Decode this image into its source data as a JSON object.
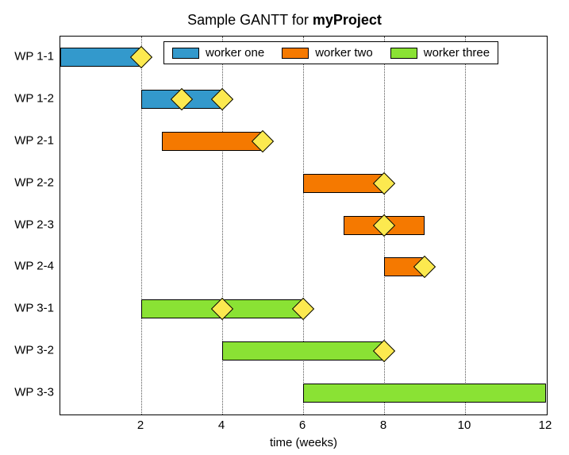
{
  "chart_data": {
    "type": "gantt",
    "title_prefix": "Sample GANTT for ",
    "title_bold": "myProject",
    "xlabel": "time (weeks)",
    "x_range": [
      0,
      12
    ],
    "x_ticks": [
      2,
      4,
      6,
      8,
      10,
      12
    ],
    "categories": [
      "WP 1-1",
      "WP 1-2",
      "WP 2-1",
      "WP 2-2",
      "WP 2-3",
      "WP 2-4",
      "WP 3-1",
      "WP 3-2",
      "WP 3-3"
    ],
    "workers": {
      "worker one": {
        "color": "#3399cc"
      },
      "worker two": {
        "color": "#f57900"
      },
      "worker three": {
        "color": "#8ae234"
      }
    },
    "legend_order": [
      "worker one",
      "worker two",
      "worker three"
    ],
    "tasks": [
      {
        "name": "WP 1-1",
        "start": 0,
        "end": 2,
        "worker": "worker one",
        "marker_at": 2
      },
      {
        "name": "WP 1-2",
        "start": 2,
        "end": 4,
        "worker": "worker one",
        "marker_at": 3,
        "extra_marker_at": 4
      },
      {
        "name": "WP 2-1",
        "start": 2.5,
        "end": 5,
        "worker": "worker two",
        "marker_at": 5
      },
      {
        "name": "WP 2-2",
        "start": 6,
        "end": 8,
        "worker": "worker two",
        "marker_at": 8
      },
      {
        "name": "WP 2-3",
        "start": 7,
        "end": 9,
        "worker": "worker two",
        "marker_at": 8
      },
      {
        "name": "WP 2-4",
        "start": 8,
        "end": 9,
        "worker": "worker two",
        "marker_at": 9
      },
      {
        "name": "WP 3-1",
        "start": 2,
        "end": 6,
        "worker": "worker three",
        "marker_at": 4,
        "extra_marker_at": 6
      },
      {
        "name": "WP 3-2",
        "start": 4,
        "end": 8,
        "worker": "worker three",
        "marker_at": 8
      },
      {
        "name": "WP 3-3",
        "start": 6,
        "end": 12,
        "worker": "worker three"
      }
    ]
  }
}
